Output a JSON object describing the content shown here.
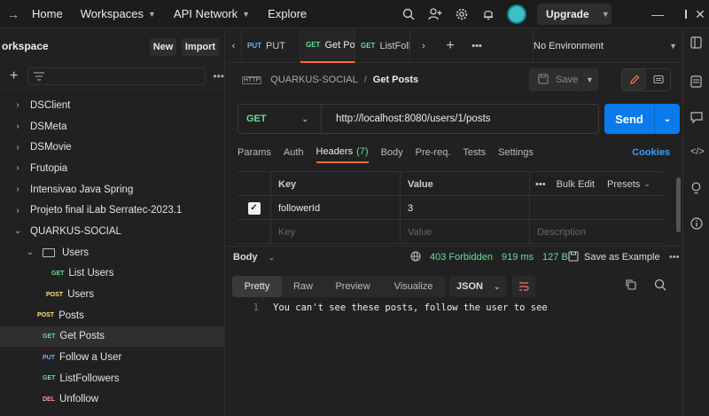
{
  "topbar": {
    "home": "Home",
    "workspaces": "Workspaces",
    "api_network": "API Network",
    "explore": "Explore",
    "upgrade": "Upgrade"
  },
  "sidebar": {
    "title": "orkspace",
    "new_label": "New",
    "import_label": "Import",
    "items": [
      {
        "label": "DSClient",
        "method": ""
      },
      {
        "label": "DSMeta",
        "method": ""
      },
      {
        "label": "DSMovie",
        "method": ""
      },
      {
        "label": "Frutopia",
        "method": ""
      },
      {
        "label": "Intensivao Java Spring",
        "method": ""
      },
      {
        "label": "Projeto final iLab Serratec-2023.1",
        "method": ""
      },
      {
        "label": "QUARKUS-SOCIAL",
        "method": ""
      },
      {
        "label": "Users",
        "method": ""
      },
      {
        "label": "List Users",
        "method": "GET"
      },
      {
        "label": "Users",
        "method": "POST"
      },
      {
        "label": "Posts",
        "method": "POST"
      },
      {
        "label": "Get Posts",
        "method": "GET"
      },
      {
        "label": "Follow a User",
        "method": "PUT"
      },
      {
        "label": "ListFollowers",
        "method": "GET"
      },
      {
        "label": "Unfollow",
        "method": "DEL"
      }
    ]
  },
  "tabs": {
    "items": [
      {
        "method": "PUT",
        "label": "PUT"
      },
      {
        "method": "GET",
        "label": "Get Po"
      },
      {
        "method": "GET",
        "label": "ListFoll"
      }
    ],
    "environment": "No Environment"
  },
  "request": {
    "http_badge": "HTTP",
    "collection": "QUARKUS-SOCIAL",
    "separator": "/",
    "name": "Get Posts",
    "save_label": "Save",
    "method": "GET",
    "url": "http://localhost:8080/users/1/posts",
    "send_label": "Send",
    "tabs": [
      "Params",
      "Auth",
      "Headers",
      "Body",
      "Pre-req.",
      "Tests",
      "Settings"
    ],
    "headers_count": "(7)",
    "cookies": "Cookies",
    "table": {
      "col_key": "Key",
      "col_value": "Value",
      "bulk_edit": "Bulk Edit",
      "presets": "Presets",
      "row_key": "followerId",
      "row_value": "3",
      "ph_key": "Key",
      "ph_value": "Value",
      "ph_desc": "Description"
    }
  },
  "response": {
    "body_label": "Body",
    "status": "403 Forbidden",
    "time": "919 ms",
    "size": "127 B",
    "save_example": "Save as Example",
    "formats": [
      "Pretty",
      "Raw",
      "Preview",
      "Visualize"
    ],
    "language": "JSON",
    "line_no": "1",
    "line_text": "You can't see these posts, follow the user to see"
  }
}
